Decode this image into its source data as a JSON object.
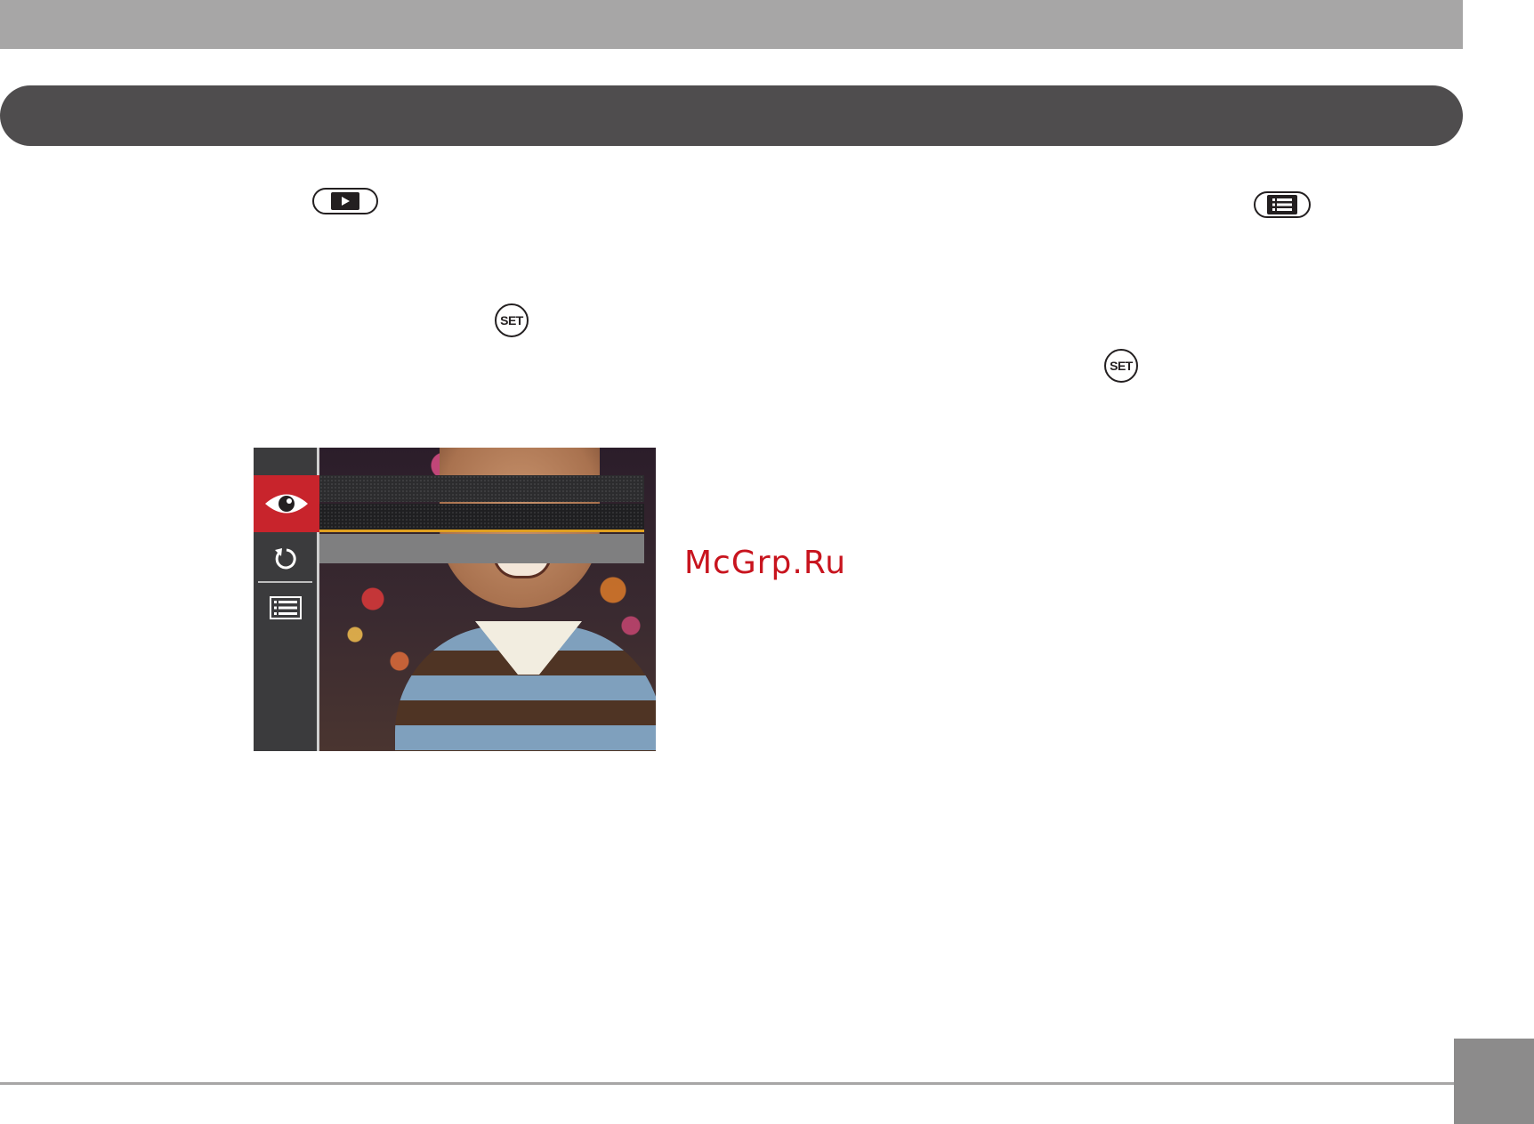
{
  "watermark": {
    "text": "McGrp.Ru"
  },
  "buttons": {
    "play": "play-button-icon",
    "menu": "menu-button-icon",
    "set_label": "SET"
  },
  "camera_screen": {
    "tabs": [
      "eye-icon",
      "rotate-icon",
      "menu-list-icon"
    ],
    "active_tab": "eye-icon",
    "accent_color": "#c8242c",
    "highlight_color": "#e0a020"
  }
}
